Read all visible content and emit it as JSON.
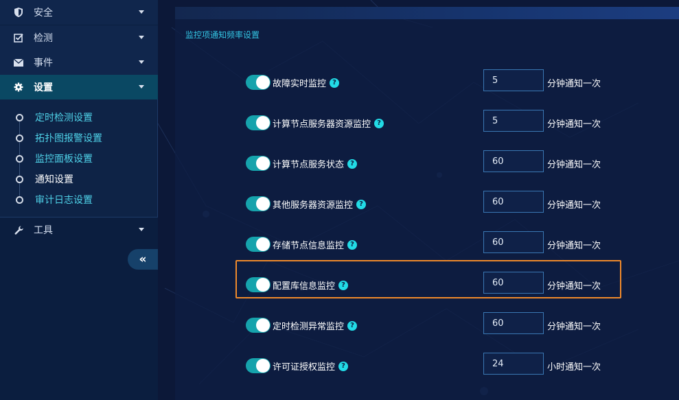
{
  "sidebar": {
    "items": [
      {
        "label": "安全",
        "icon": "shield-icon"
      },
      {
        "label": "检测",
        "icon": "check-square-icon"
      },
      {
        "label": "事件",
        "icon": "envelope-icon"
      },
      {
        "label": "设置",
        "icon": "gear-icon"
      },
      {
        "label": "工具",
        "icon": "wrench-icon"
      }
    ],
    "submenu": [
      {
        "label": "定时检测设置"
      },
      {
        "label": "拓扑图报警设置"
      },
      {
        "label": "监控面板设置"
      },
      {
        "label": "通知设置"
      },
      {
        "label": "审计日志设置"
      }
    ],
    "collapse_symbol": "«"
  },
  "main": {
    "section_title": "监控项通知频率设置",
    "help_symbol": "?",
    "rows": [
      {
        "label": "故障实时监控",
        "value": "5",
        "unit": "分钟通知一次",
        "enabled": true
      },
      {
        "label": "计算节点服务器资源监控",
        "value": "5",
        "unit": "分钟通知一次",
        "enabled": true
      },
      {
        "label": "计算节点服务状态",
        "value": "60",
        "unit": "分钟通知一次",
        "enabled": true
      },
      {
        "label": "其他服务器资源监控",
        "value": "60",
        "unit": "分钟通知一次",
        "enabled": true
      },
      {
        "label": "存储节点信息监控",
        "value": "60",
        "unit": "分钟通知一次",
        "enabled": true
      },
      {
        "label": "配置库信息监控",
        "value": "60",
        "unit": "分钟通知一次",
        "enabled": true
      },
      {
        "label": "定时检测异常监控",
        "value": "60",
        "unit": "分钟通知一次",
        "enabled": true
      },
      {
        "label": "许可证授权监控",
        "value": "24",
        "unit": "小时通知一次",
        "enabled": true
      }
    ]
  },
  "colors": {
    "accent": "#16a3ac",
    "highlight": "#f08a2b",
    "title": "#34c6e4"
  }
}
